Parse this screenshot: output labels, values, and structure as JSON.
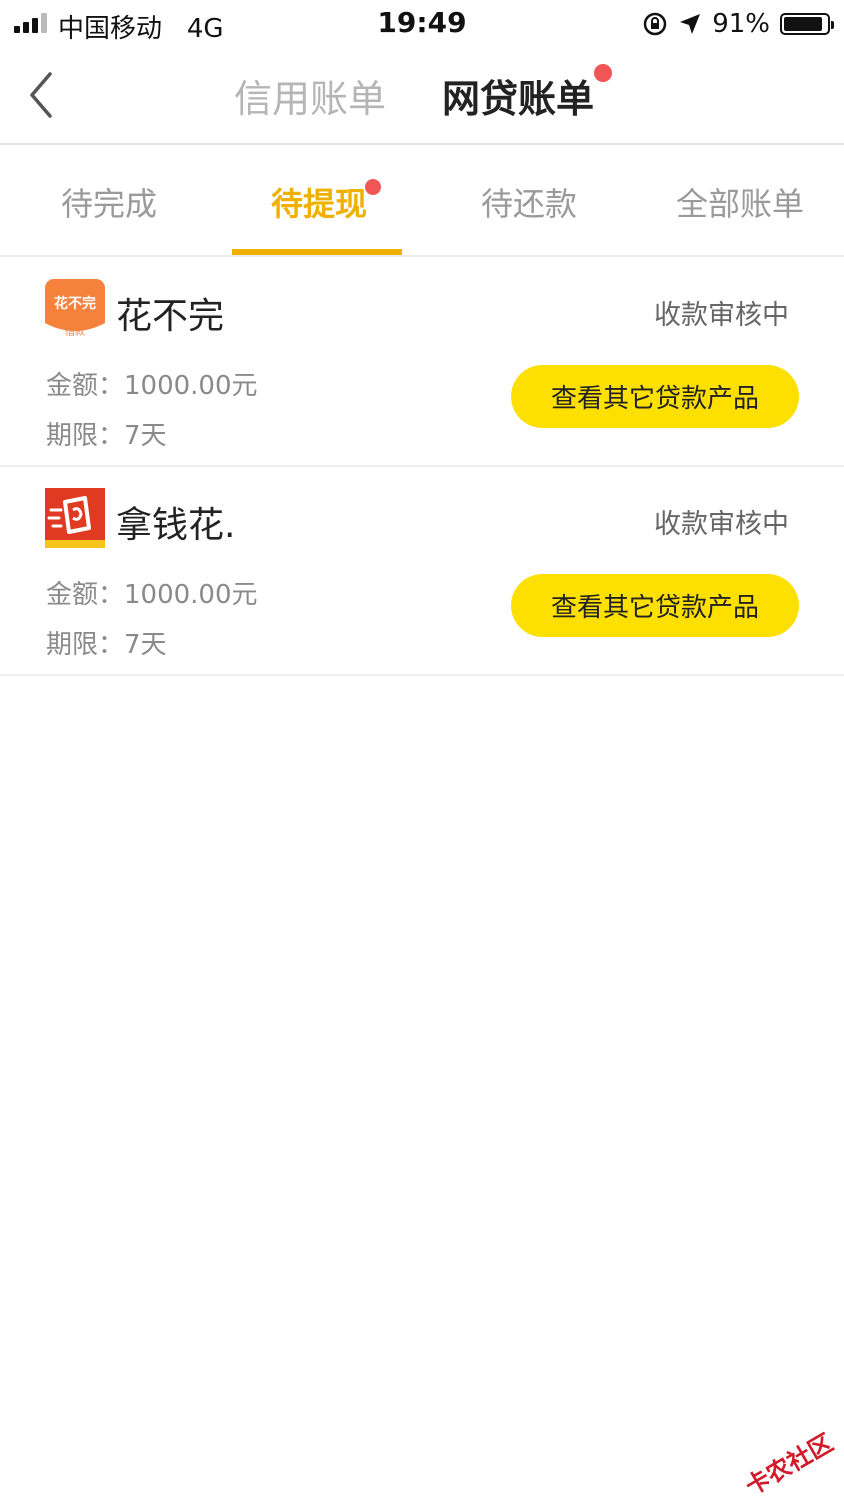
{
  "status_bar": {
    "carrier": "中国移动",
    "network": "4G",
    "time": "19:49",
    "battery_text": "91%",
    "battery_level": 0.91
  },
  "nav": {
    "tabs": [
      {
        "label": "信用账单",
        "active": false
      },
      {
        "label": "网贷账单",
        "active": true,
        "badge_dot": true
      }
    ]
  },
  "subtabs": [
    {
      "label": "待完成",
      "active": false
    },
    {
      "label": "待提现",
      "active": true,
      "badge_dot": true
    },
    {
      "label": "待还款",
      "active": false
    },
    {
      "label": "全部账单",
      "active": false
    }
  ],
  "loans": [
    {
      "name": "花不完",
      "logo_text": "花不完",
      "logo_subtext": "借款",
      "logo_icon": "huabuwan-logo",
      "status": "收款审核中",
      "amount": "金额：1000.00元",
      "period": "期限：7天",
      "button": "查看其它贷款产品"
    },
    {
      "name": "拿钱花.",
      "logo_icon": "naqianhua-logo",
      "status": "收款审核中",
      "amount": "金额：1000.00元",
      "period": "期限：7天",
      "button": "查看其它贷款产品"
    }
  ],
  "watermark": "卡农社区",
  "colors": {
    "accent": "#f0b000",
    "button": "#fde000",
    "badge": "#f25555",
    "logo_orange": "#f5813a",
    "logo_red": "#e03a22"
  }
}
